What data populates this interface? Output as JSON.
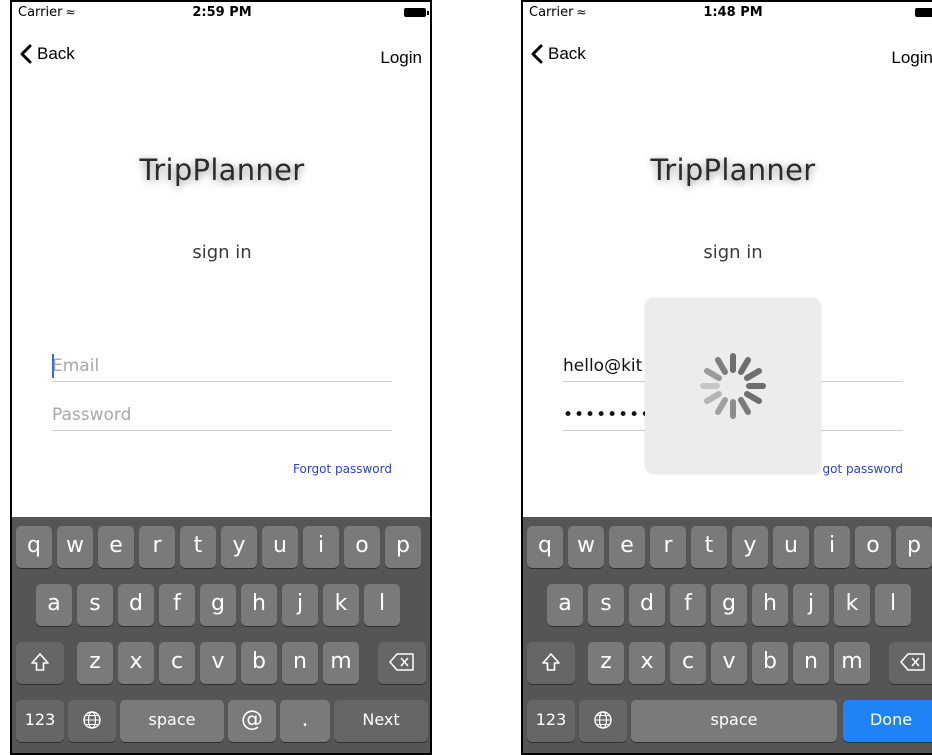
{
  "left": {
    "status": {
      "carrier": "Carrier",
      "time": "2:59 PM"
    },
    "nav": {
      "back": "Back",
      "login": "Login"
    },
    "title": "TripPlanner",
    "subtitle": "sign in",
    "email": {
      "placeholder": "Email",
      "value": ""
    },
    "password": {
      "placeholder": "Password",
      "value": ""
    },
    "forgot": "Forgot password",
    "keyboard": {
      "row1": [
        "q",
        "w",
        "e",
        "r",
        "t",
        "y",
        "u",
        "i",
        "o",
        "p"
      ],
      "row2": [
        "a",
        "s",
        "d",
        "f",
        "g",
        "h",
        "j",
        "k",
        "l"
      ],
      "row3": [
        "z",
        "x",
        "c",
        "v",
        "b",
        "n",
        "m"
      ],
      "numbers": "123",
      "space": "space",
      "at": "@",
      "dot": ".",
      "return": "Next"
    }
  },
  "right": {
    "status": {
      "carrier": "Carrier",
      "time": "1:48 PM"
    },
    "nav": {
      "back": "Back",
      "login": "Login"
    },
    "title": "TripPlanner",
    "subtitle": "sign in",
    "email": {
      "placeholder": "Email",
      "value": "hello@kit"
    },
    "password": {
      "placeholder": "Password",
      "value": "••••••••"
    },
    "forgot": "got password",
    "keyboard": {
      "row1": [
        "q",
        "w",
        "e",
        "r",
        "t",
        "y",
        "u",
        "i",
        "o",
        "p"
      ],
      "row2": [
        "a",
        "s",
        "d",
        "f",
        "g",
        "h",
        "j",
        "k",
        "l"
      ],
      "row3": [
        "z",
        "x",
        "c",
        "v",
        "b",
        "n",
        "m"
      ],
      "numbers": "123",
      "space": "space",
      "return": "Done"
    }
  },
  "colors": {
    "accent": "#2b3fe0",
    "done": "#1f82f5",
    "keyboard": "#555555",
    "key": "#7a7a7a"
  },
  "icons": [
    "chevron-left-icon",
    "wifi-icon",
    "battery-icon",
    "shift-icon",
    "delete-icon",
    "globe-icon",
    "spinner-icon"
  ]
}
